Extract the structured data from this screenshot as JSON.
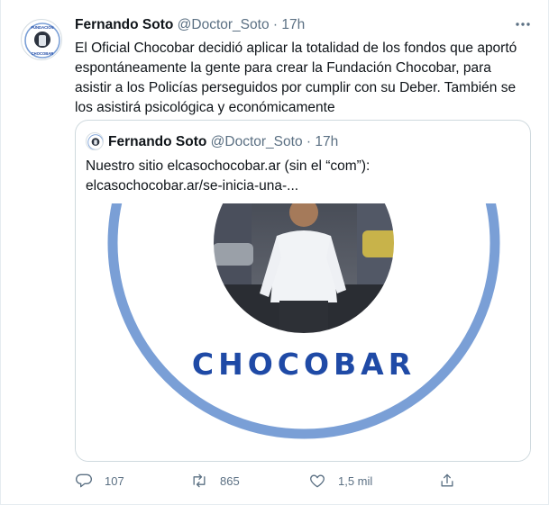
{
  "tweet": {
    "author_name": "Fernando Soto",
    "author_handle": "@Doctor_Soto",
    "separator": "·",
    "time": "17h",
    "text": "El Oficial Chocobar decidió aplicar la totalidad de los fondos que aportó espontáneamente la gente para crear la Fundación Chocobar, para asistir a los Policías perseguidos por cumplir con su Deber. También se los asistirá psicológica y económicamente",
    "avatar_text_top": "FUNDACIÓN",
    "avatar_text_bottom": "CHOCOBAR"
  },
  "quoted": {
    "author_name": "Fernando Soto",
    "author_handle": "@Doctor_Soto",
    "separator": "·",
    "time": "17h",
    "text": "Nuestro sitio elcasochocobar.ar (sin el “com”): elcasochocobar.ar/se-inicia-una-...",
    "image_word": "CHOCOBAR"
  },
  "actions": {
    "reply_count": "107",
    "retweet_count": "865",
    "like_count": "1,5 mil"
  },
  "colors": {
    "ring": "#7a9fd6",
    "word": "#1f4aa6",
    "secondary_text": "#5b7083"
  },
  "icons": [
    "more-icon",
    "reply-icon",
    "retweet-icon",
    "like-icon",
    "share-icon"
  ]
}
